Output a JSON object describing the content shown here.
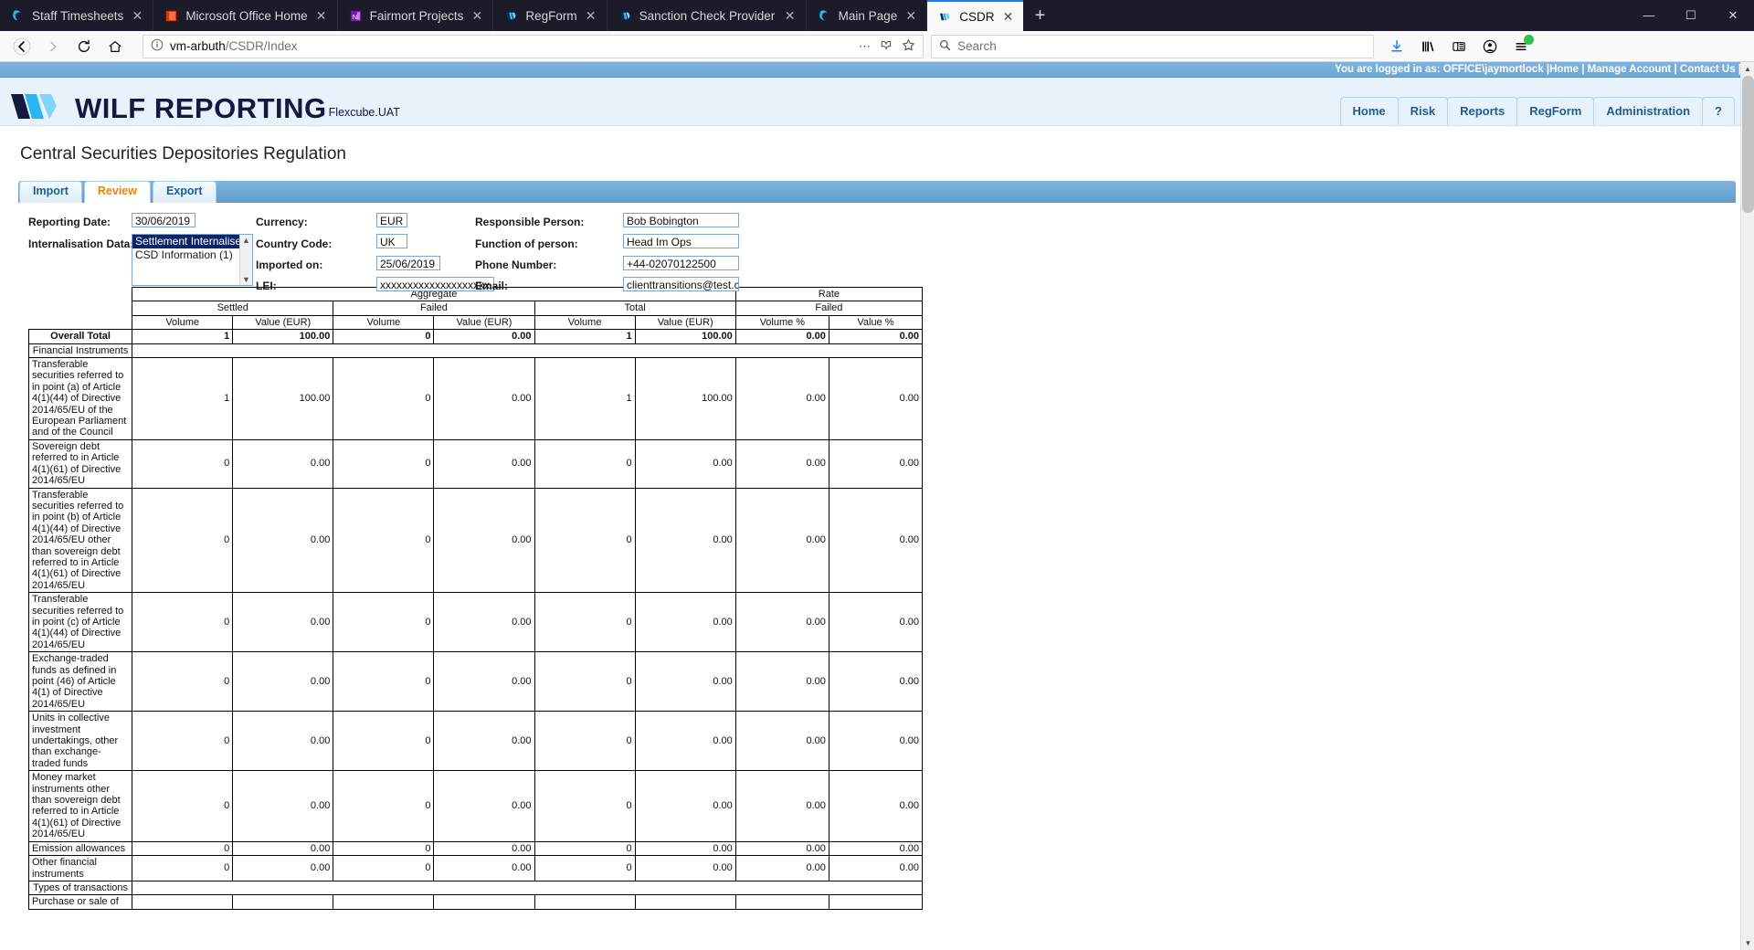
{
  "browser": {
    "tabs": [
      {
        "title": "Staff Timesheets",
        "icon": "firefox-icon",
        "active": false,
        "closable": true
      },
      {
        "title": "Microsoft Office Home",
        "icon": "office-icon",
        "active": false,
        "closable": true
      },
      {
        "title": "Fairmort Projects",
        "icon": "onenote-icon",
        "active": false,
        "closable": true
      },
      {
        "title": "RegForm",
        "icon": "wilf-icon",
        "active": false,
        "closable": true
      },
      {
        "title": "Sanction Check Provider Defini",
        "icon": "wilf-icon",
        "active": false,
        "closable": true
      },
      {
        "title": "Main Page",
        "icon": "firefox-icon",
        "active": false,
        "closable": true
      },
      {
        "title": "CSDR",
        "icon": "wilf-icon",
        "active": true,
        "closable": true
      }
    ],
    "new_tab_label": "+",
    "window_controls": {
      "minimize": "—",
      "maximize": "☐",
      "close": "✕"
    },
    "url": {
      "domain": "vm-arbuth",
      "path": "/CSDR/Index"
    },
    "search_placeholder": "Search",
    "nav": {
      "back": "←",
      "forward": "→",
      "reload": "↻",
      "home": "⌂"
    }
  },
  "loginbar": {
    "text": "You are logged in as: OFFICE\\jaymortlock |",
    "links": [
      "Home",
      "Manage Account",
      "Contact Us"
    ],
    "trailing": "|"
  },
  "brand": {
    "name": "WILF REPORTING",
    "environment": "Flexcube.UAT",
    "logo_colors": [
      "#14193f",
      "#29b6f6",
      "#81d4fa"
    ]
  },
  "topnav": {
    "items": [
      "Home",
      "Risk",
      "Reports",
      "RegForm",
      "Administration",
      "?"
    ]
  },
  "page": {
    "title": "Central Securities Depositories Regulation",
    "tabs": [
      {
        "label": "Import",
        "selected": false
      },
      {
        "label": "Review",
        "selected": true
      },
      {
        "label": "Export",
        "selected": false
      }
    ]
  },
  "form": {
    "reporting_date": {
      "label": "Reporting Date:",
      "value": "30/06/2019"
    },
    "internalisation_data": {
      "label": "Internalisation Data:",
      "options": [
        "Settlement Internaliser",
        "CSD Information (1)"
      ],
      "selected": "Settlement Internaliser"
    },
    "currency": {
      "label": "Currency:",
      "value": "EUR"
    },
    "country_code": {
      "label": "Country Code:",
      "value": "UK"
    },
    "imported_on": {
      "label": "Imported on:",
      "value": "25/06/2019"
    },
    "lei": {
      "label": "LEI:",
      "value": "xxxxxxxxxxxxxxxxxxxx"
    },
    "responsible_person": {
      "label": "Responsible Person:",
      "value": "Bob Bobington"
    },
    "function_of_person": {
      "label": "Function of person:",
      "value": "Head Im Ops"
    },
    "phone_number": {
      "label": "Phone Number:",
      "value": "+44-02070122500"
    },
    "email": {
      "label": "Email:",
      "value": "clienttransitions@test.co.uk"
    }
  },
  "report_table": {
    "group_headers": [
      {
        "label": "",
        "span": 1
      },
      {
        "label": "Aggregate",
        "span": 6
      },
      {
        "label": "Rate",
        "span": 2
      }
    ],
    "sub_headers": [
      {
        "label": "",
        "span": 1
      },
      {
        "label": "Settled",
        "span": 2
      },
      {
        "label": "Failed",
        "span": 2
      },
      {
        "label": "Total",
        "span": 2
      },
      {
        "label": "Failed",
        "span": 2
      }
    ],
    "column_headers": [
      "",
      "Volume",
      "Value (EUR)",
      "Volume",
      "Value (EUR)",
      "Volume",
      "Value (EUR)",
      "Volume %",
      "Value %"
    ],
    "overall_total": {
      "label": "Overall Total",
      "values": [
        "1",
        "100.00",
        "0",
        "0.00",
        "1",
        "100.00",
        "0.00",
        "0.00"
      ]
    },
    "sections": [
      {
        "title": "Financial Instruments",
        "rows": [
          {
            "label": "Transferable securities referred to in point (a) of Article 4(1)(44) of Directive 2014/65/EU of the European Parliament and of the Council",
            "values": [
              "1",
              "100.00",
              "0",
              "0.00",
              "1",
              "100.00",
              "0.00",
              "0.00"
            ]
          },
          {
            "label": "Sovereign debt referred to in Article 4(1)(61) of Directive 2014/65/EU",
            "values": [
              "0",
              "0.00",
              "0",
              "0.00",
              "0",
              "0.00",
              "0.00",
              "0.00"
            ]
          },
          {
            "label": "Transferable securities referred to in point (b) of Article 4(1)(44) of Directive 2014/65/EU other than sovereign debt referred to in Article 4(1)(61) of Directive 2014/65/EU",
            "values": [
              "0",
              "0.00",
              "0",
              "0.00",
              "0",
              "0.00",
              "0.00",
              "0.00"
            ]
          },
          {
            "label": "Transferable securities referred to in point (c) of Article 4(1)(44) of Directive 2014/65/EU",
            "values": [
              "0",
              "0.00",
              "0",
              "0.00",
              "0",
              "0.00",
              "0.00",
              "0.00"
            ]
          },
          {
            "label": "Exchange-traded funds as defined in point (46) of Article 4(1) of Directive 2014/65/EU",
            "values": [
              "0",
              "0.00",
              "0",
              "0.00",
              "0",
              "0.00",
              "0.00",
              "0.00"
            ]
          },
          {
            "label": "Units in collective investment undertakings, other than exchange-traded funds",
            "values": [
              "0",
              "0.00",
              "0",
              "0.00",
              "0",
              "0.00",
              "0.00",
              "0.00"
            ]
          },
          {
            "label": "Money market instruments other than sovereign debt referred to in Article 4(1)(61) of Directive 2014/65/EU",
            "values": [
              "0",
              "0.00",
              "0",
              "0.00",
              "0",
              "0.00",
              "0.00",
              "0.00"
            ]
          },
          {
            "label": "Emission allowances",
            "values": [
              "0",
              "0.00",
              "0",
              "0.00",
              "0",
              "0.00",
              "0.00",
              "0.00"
            ]
          },
          {
            "label": "Other financial instruments",
            "values": [
              "0",
              "0.00",
              "0",
              "0.00",
              "0",
              "0.00",
              "0.00",
              "0.00"
            ]
          }
        ]
      },
      {
        "title": "Types of transactions",
        "rows": [
          {
            "label": "Purchase or sale of",
            "values": [
              "",
              "",
              "",
              "",
              "",
              "",
              "",
              ""
            ]
          }
        ]
      }
    ]
  }
}
